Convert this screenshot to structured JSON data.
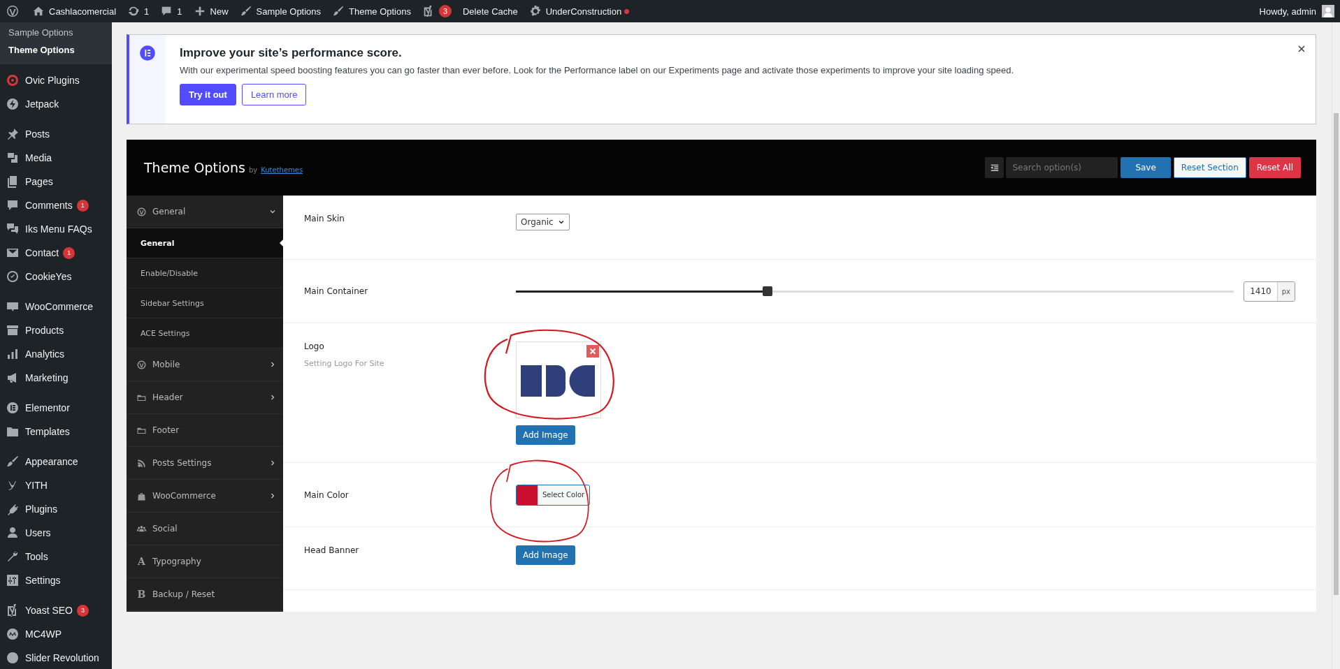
{
  "admin_bar": {
    "site": "Cashlacomercial",
    "updates": "1",
    "comments": "1",
    "new": "New",
    "items": [
      "Sample Options",
      "Theme Options"
    ],
    "yoast_badge": "3",
    "delete_cache": "Delete Cache",
    "maintenance": {
      "label": "UnderConstruction",
      "color": "#d63638"
    },
    "greeting": "Howdy, admin"
  },
  "sidebar": {
    "submenu": [
      {
        "label": "Sample Options",
        "selected": false
      },
      {
        "label": "Theme Options",
        "selected": true
      }
    ],
    "groups": [
      [
        {
          "label": "Ovic Plugins",
          "selected": false
        },
        {
          "label": "Jetpack",
          "selected": false
        }
      ],
      [
        {
          "label": "Posts",
          "selected": false
        },
        {
          "label": "Media",
          "selected": false
        },
        {
          "label": "Pages",
          "selected": false
        },
        {
          "label": "Comments",
          "badge": "1",
          "selected": false
        },
        {
          "label": "Iks Menu FAQs",
          "selected": false
        },
        {
          "label": "Contact",
          "badge": "1",
          "selected": false
        },
        {
          "label": "CookieYes",
          "selected": false
        }
      ],
      [
        {
          "label": "WooCommerce",
          "selected": false
        },
        {
          "label": "Products",
          "selected": false
        },
        {
          "label": "Analytics",
          "selected": false
        },
        {
          "label": "Marketing",
          "selected": false
        }
      ],
      [
        {
          "label": "Elementor",
          "selected": false
        },
        {
          "label": "Templates",
          "selected": false
        }
      ],
      [
        {
          "label": "Appearance",
          "selected": false
        },
        {
          "label": "YITH",
          "selected": false
        },
        {
          "label": "Plugins",
          "selected": false
        },
        {
          "label": "Users",
          "selected": false
        },
        {
          "label": "Tools",
          "selected": false
        },
        {
          "label": "Settings",
          "selected": false
        }
      ],
      [
        {
          "label": "Yoast SEO",
          "badge": "3",
          "selected": false
        },
        {
          "label": "MC4WP",
          "selected": false
        },
        {
          "label": "Slider Revolution",
          "selected": false
        }
      ]
    ]
  },
  "notice": {
    "title": "Improve your site’s performance score.",
    "text": "With our experimental speed boosting features you can go faster than ever before. Look for the Performance label on our Experiments page and activate those experiments to improve your site loading speed.",
    "primary_button": "Try it out",
    "secondary_button": "Learn more"
  },
  "panel": {
    "title": "Theme Options",
    "by": "by",
    "author": "Kutethemes",
    "search": {
      "placeholder": "Search option(s)"
    },
    "buttons": [
      {
        "label": "Save",
        "kind": "primary"
      },
      {
        "label": "Reset Section",
        "kind": "secondary"
      },
      {
        "label": "Reset All",
        "kind": "danger"
      }
    ],
    "menu": [
      {
        "label": "General",
        "selected": false,
        "expandable": true,
        "expanded": true,
        "children": [
          {
            "label": "General",
            "selected": true
          },
          {
            "label": "Enable/Disable",
            "selected": false
          },
          {
            "label": "Sidebar Settings",
            "selected": false
          },
          {
            "label": "ACE Settings",
            "selected": false
          }
        ]
      },
      {
        "label": "Mobile",
        "selected": false,
        "expandable": true,
        "expanded": false
      },
      {
        "label": "Header",
        "selected": false,
        "expandable": true,
        "expanded": false
      },
      {
        "label": "Footer",
        "selected": false,
        "expandable": false
      },
      {
        "label": "Posts Settings",
        "selected": false,
        "expandable": true,
        "expanded": false
      },
      {
        "label": "WooCommerce",
        "selected": false,
        "expandable": true,
        "expanded": false
      },
      {
        "label": "Social",
        "selected": false,
        "expandable": false
      },
      {
        "label": "Typography",
        "glyph": "A",
        "selected": false,
        "expandable": false
      },
      {
        "label": "Backup / Reset",
        "glyph": "B",
        "selected": false,
        "expandable": false
      }
    ],
    "fields": [
      {
        "kind": "select",
        "label": "Main Skin",
        "value": "Organic",
        "circled": false
      },
      {
        "kind": "slider",
        "label": "Main Container",
        "level": 0.35,
        "value": "1410",
        "unit": "px",
        "circled": false
      },
      {
        "kind": "image",
        "label": "Logo",
        "description": "Setting Logo For Site",
        "has_image": true,
        "button": "Add Image",
        "circled": true
      },
      {
        "kind": "color",
        "label": "Main Color",
        "color": "#c8102e",
        "button": "Select Color",
        "circled": true
      },
      {
        "kind": "image",
        "label": "Head Banner",
        "has_image": false,
        "button": "Add Image",
        "circled": false
      }
    ]
  }
}
